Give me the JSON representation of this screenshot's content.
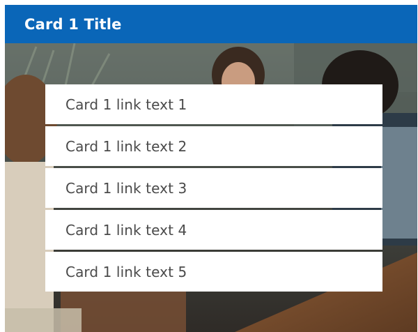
{
  "card": {
    "title": "Card 1 Title",
    "colors": {
      "header": "#0a66b8",
      "title_text": "#ffffff",
      "link_text": "#4a4a4a",
      "link_background": "#ffffff"
    },
    "image": "photo of people meeting around a wooden table",
    "links": [
      {
        "label": "Card 1 link text 1"
      },
      {
        "label": "Card 1 link text 2"
      },
      {
        "label": "Card 1 link text 3"
      },
      {
        "label": "Card 1 link text 4"
      },
      {
        "label": "Card 1 link text 5"
      }
    ]
  }
}
